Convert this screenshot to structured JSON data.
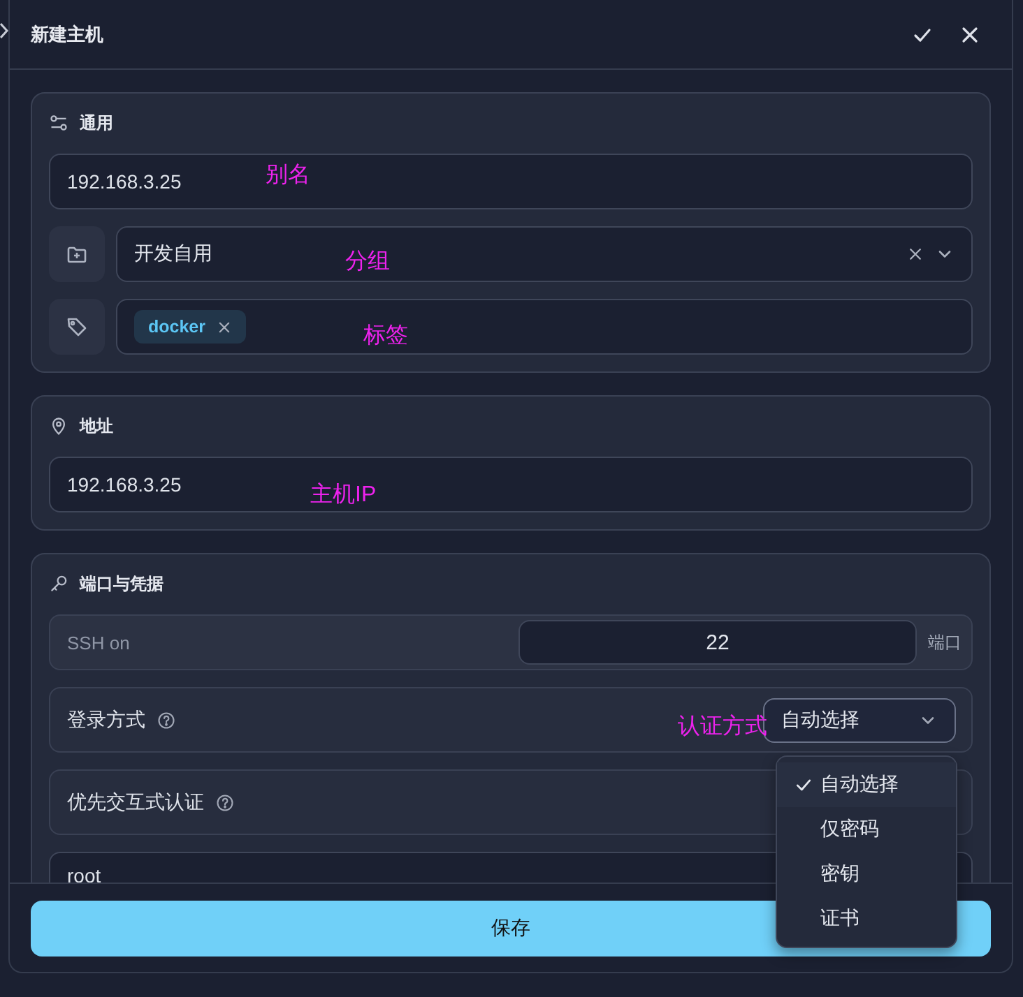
{
  "dialog": {
    "title": "新建主机"
  },
  "general": {
    "title": "通用",
    "alias": {
      "value": "192.168.3.25",
      "annotation": "别名"
    },
    "group": {
      "value": "开发自用",
      "annotation": "分组"
    },
    "tags": {
      "items": [
        {
          "label": "docker"
        }
      ],
      "annotation": "标签"
    }
  },
  "address": {
    "title": "地址",
    "host": {
      "value": "192.168.3.25",
      "annotation": "主机IP"
    }
  },
  "credentials": {
    "title": "端口与凭据",
    "port": {
      "label": "SSH on",
      "value": "22",
      "unit": "端口"
    },
    "login_method": {
      "label": "登录方式",
      "annotation": "认证方式",
      "value": "自动选择",
      "expanded": true,
      "options": [
        {
          "label": "自动选择",
          "selected": true
        },
        {
          "label": "仅密码",
          "selected": false
        },
        {
          "label": "密钥",
          "selected": false
        },
        {
          "label": "证书",
          "selected": false
        }
      ]
    },
    "interactive_auth": {
      "label": "优先交互式认证"
    },
    "username": {
      "value": "root"
    }
  },
  "footer": {
    "save": "保存"
  }
}
